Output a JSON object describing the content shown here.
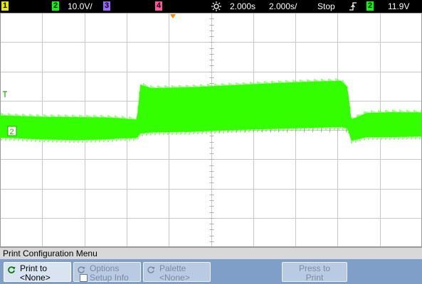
{
  "status": {
    "ch1": "1",
    "ch2": "2",
    "ch2_scale": "10.0V/",
    "ch3": "3",
    "ch4": "4",
    "timebase_delay": "2.000s",
    "timebase_scale": "2.000s/",
    "run_state": "Stop",
    "trigger_source": "2",
    "trigger_level": "11.9V",
    "colors": {
      "ch1": "#e8e800",
      "ch2": "#00ff00",
      "ch3": "#9966ff",
      "ch4": "#ff5599"
    }
  },
  "screen": {
    "trigger_marker": "T",
    "ground_marker": "2",
    "trace_color": "#33ff00",
    "trace_envelope": [
      {
        "t": 0.0,
        "hi": 0.52,
        "lo": -0.24
      },
      {
        "t": 0.04,
        "hi": 0.5,
        "lo": -0.26
      },
      {
        "t": 0.1,
        "hi": 0.47,
        "lo": -0.3
      },
      {
        "t": 0.18,
        "hi": 0.46,
        "lo": -0.32
      },
      {
        "t": 0.25,
        "hi": 0.45,
        "lo": -0.3
      },
      {
        "t": 0.29,
        "hi": 0.42,
        "lo": -0.26
      },
      {
        "t": 0.31,
        "hi": 0.39,
        "lo": -0.26
      },
      {
        "t": 0.325,
        "hi": 0.38,
        "lo": -0.25
      },
      {
        "t": 0.333,
        "hi": 1.57,
        "lo": -0.1
      },
      {
        "t": 0.36,
        "hi": 1.45,
        "lo": -0.06
      },
      {
        "t": 0.45,
        "hi": 1.48,
        "lo": -0.04
      },
      {
        "t": 0.55,
        "hi": 1.55,
        "lo": 0.02
      },
      {
        "t": 0.65,
        "hi": 1.62,
        "lo": 0.06
      },
      {
        "t": 0.75,
        "hi": 1.68,
        "lo": 0.1
      },
      {
        "t": 0.81,
        "hi": 1.7,
        "lo": 0.12
      },
      {
        "t": 0.825,
        "hi": 1.48,
        "lo": 0.08
      },
      {
        "t": 0.834,
        "hi": 0.38,
        "lo": -0.35
      },
      {
        "t": 0.87,
        "hi": 0.6,
        "lo": -0.22
      },
      {
        "t": 0.93,
        "hi": 0.63,
        "lo": -0.22
      },
      {
        "t": 1.0,
        "hi": 0.62,
        "lo": -0.2
      }
    ]
  },
  "menu": {
    "title": "Print Configuration Menu",
    "softkeys": [
      {
        "line1": "Print to",
        "line2": "<None>",
        "state": "active",
        "icon": "cycle-icon"
      },
      {
        "line1": "Options",
        "line2": "Setup Info",
        "state": "disabled",
        "icon": "cycle-icon"
      },
      {
        "line1": "Palette",
        "line2": "<None>",
        "state": "disabled",
        "icon": "cycle-icon"
      },
      {
        "line1": "Press to",
        "line2": "Print",
        "state": "disabled",
        "icon": ""
      }
    ]
  }
}
